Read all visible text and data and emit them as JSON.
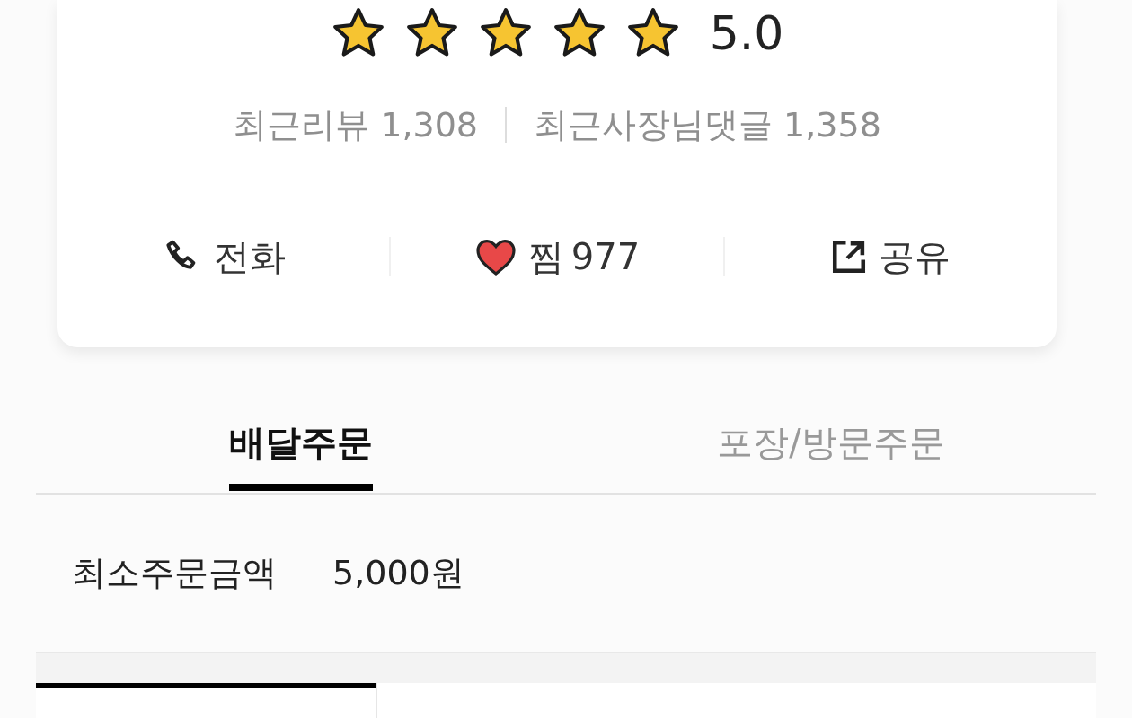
{
  "rating": {
    "stars": 5,
    "score": "5.0"
  },
  "stats": [
    {
      "label": "최근리뷰 1,308"
    },
    {
      "label": "최근사장님댓글 1,358"
    }
  ],
  "actions": [
    {
      "kind": "phone",
      "label": "전화"
    },
    {
      "kind": "heart",
      "label": "찜",
      "count": "977"
    },
    {
      "kind": "share",
      "label": "공유"
    }
  ],
  "tabs": [
    {
      "label": "배달주문",
      "selected": true
    },
    {
      "label": "포장/방문주문",
      "selected": false
    }
  ],
  "min_order": {
    "label": "최소주문금액",
    "value": "5,000원"
  }
}
